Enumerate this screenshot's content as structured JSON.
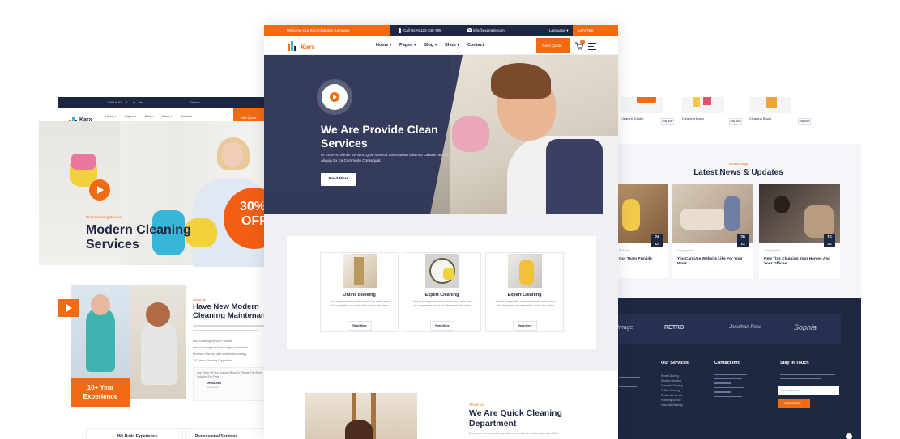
{
  "left_mockup": {
    "brand": "Karx",
    "top_links": [
      "Call Us At",
      "f",
      "in",
      "tw",
      "Search"
    ],
    "nav": [
      "Home ▾",
      "Pages ▾",
      "Blog ▾",
      "Shop ▾",
      "Contact"
    ],
    "get_quote": "Get Quote",
    "hero_kicker": "Best Cleaning Service",
    "hero_title": "Modern Cleaning Services",
    "offer_percent": "30%",
    "offer_label": "OFF",
    "about_kicker": "About us",
    "about_title": "Have New Modern Cleaning Maintenance",
    "checklist": [
      "Best Cleaning Service Provider",
      "Best Cleaning And Technology Commitment",
      "Provision Working with modern technology",
      "24/7 Hour Cleaning Supportive"
    ],
    "quote_text": "Our Team Of Our Support Busy To Repair The Best Solution For Pest",
    "quote_name": "Dmith Jina",
    "quote_role": "Our Owner",
    "experience_years": "10+ Year",
    "experience_label": "Experience",
    "bottom_cards": [
      "We Build Experience",
      "Professional Services"
    ]
  },
  "center_mockup": {
    "topbar": {
      "welcome": "Welcome Our Karx Cleaning Company",
      "call": "Call Us At 123-345-789",
      "email": "info@example.com",
      "language": "Language ▾",
      "talk": "Let's Talk"
    },
    "brand": "Karx",
    "nav": [
      "Home ▾",
      "Pages ▾",
      "Blog ▾",
      "Shop ▾",
      "Contact"
    ],
    "get_quote": "Get A Quote",
    "cart_count": "0",
    "hero": {
      "title": "We Are Provide Clean Services",
      "description": "Ut Enim Ad Minim Veniam, Quis Nostrud Exercitation Ullamco Laboris Nisi Ut Aliquip Ex Ea Commodo Consequat.",
      "button": "Read More"
    },
    "services": [
      {
        "title": "Online Booking",
        "description": "Sed ut perspiciatis unde omnis iste natus error sit voluptatem accusam tide omnis iste natus",
        "button": "Read More"
      },
      {
        "title": "Expert Cleaning",
        "description": "Sed ut perspiciatis unde omnis iste natus error sit voluptatem accusam tide omnis iste natus",
        "button": "Read More"
      },
      {
        "title": "Expert Cleaning",
        "description": "Sed ut perspiciatis unde omnis iste natus error sit voluptatem accusam tide omnis iste natus",
        "button": "Read More"
      }
    ],
    "about": {
      "kicker": "About us",
      "title": "We Are Quick Cleaning Department",
      "description": "Excepteur sint occaecat cupidatat non proident, sunt in culpa qui officia"
    }
  },
  "right_mockup": {
    "products": [
      {
        "name": "Cleaning Duster",
        "button": "Buy Now"
      },
      {
        "name": "Cleaning Dusty",
        "button": "Buy Now"
      },
      {
        "name": "Cleaning Brush",
        "button": "Buy Now"
      }
    ],
    "news_kicker": "Recent Blogs",
    "news_title": "Latest News & Updates",
    "news": [
      {
        "meta": "By Admin",
        "title": "Our Team Provide",
        "day": "24",
        "month": "Jan"
      },
      {
        "meta": "Cleaning Work",
        "title": "You Can Use Website Like For Your Work",
        "day": "20",
        "month": "Jan"
      },
      {
        "meta": "Cleaning Work",
        "title": "New Tips Cleaning Your Homes And Your Offices",
        "day": "15",
        "month": "Jan"
      }
    ],
    "partner_logos": [
      "Image",
      "RETRO",
      "Jonathan Ross",
      "Sophia"
    ],
    "footer_columns": [
      "Our Services",
      "Contact Info",
      "Stay In Touch"
    ],
    "service_links": [
      "Home Cleaning",
      "Window Cleaning",
      "Domestic Cleaning",
      "Pollute Cleaning",
      "Residential Service",
      "Plumbing Service",
      "Industrial Cleaning"
    ],
    "email_placeholder": "Email Address",
    "subscribe": "SUBSCRIBE"
  }
}
